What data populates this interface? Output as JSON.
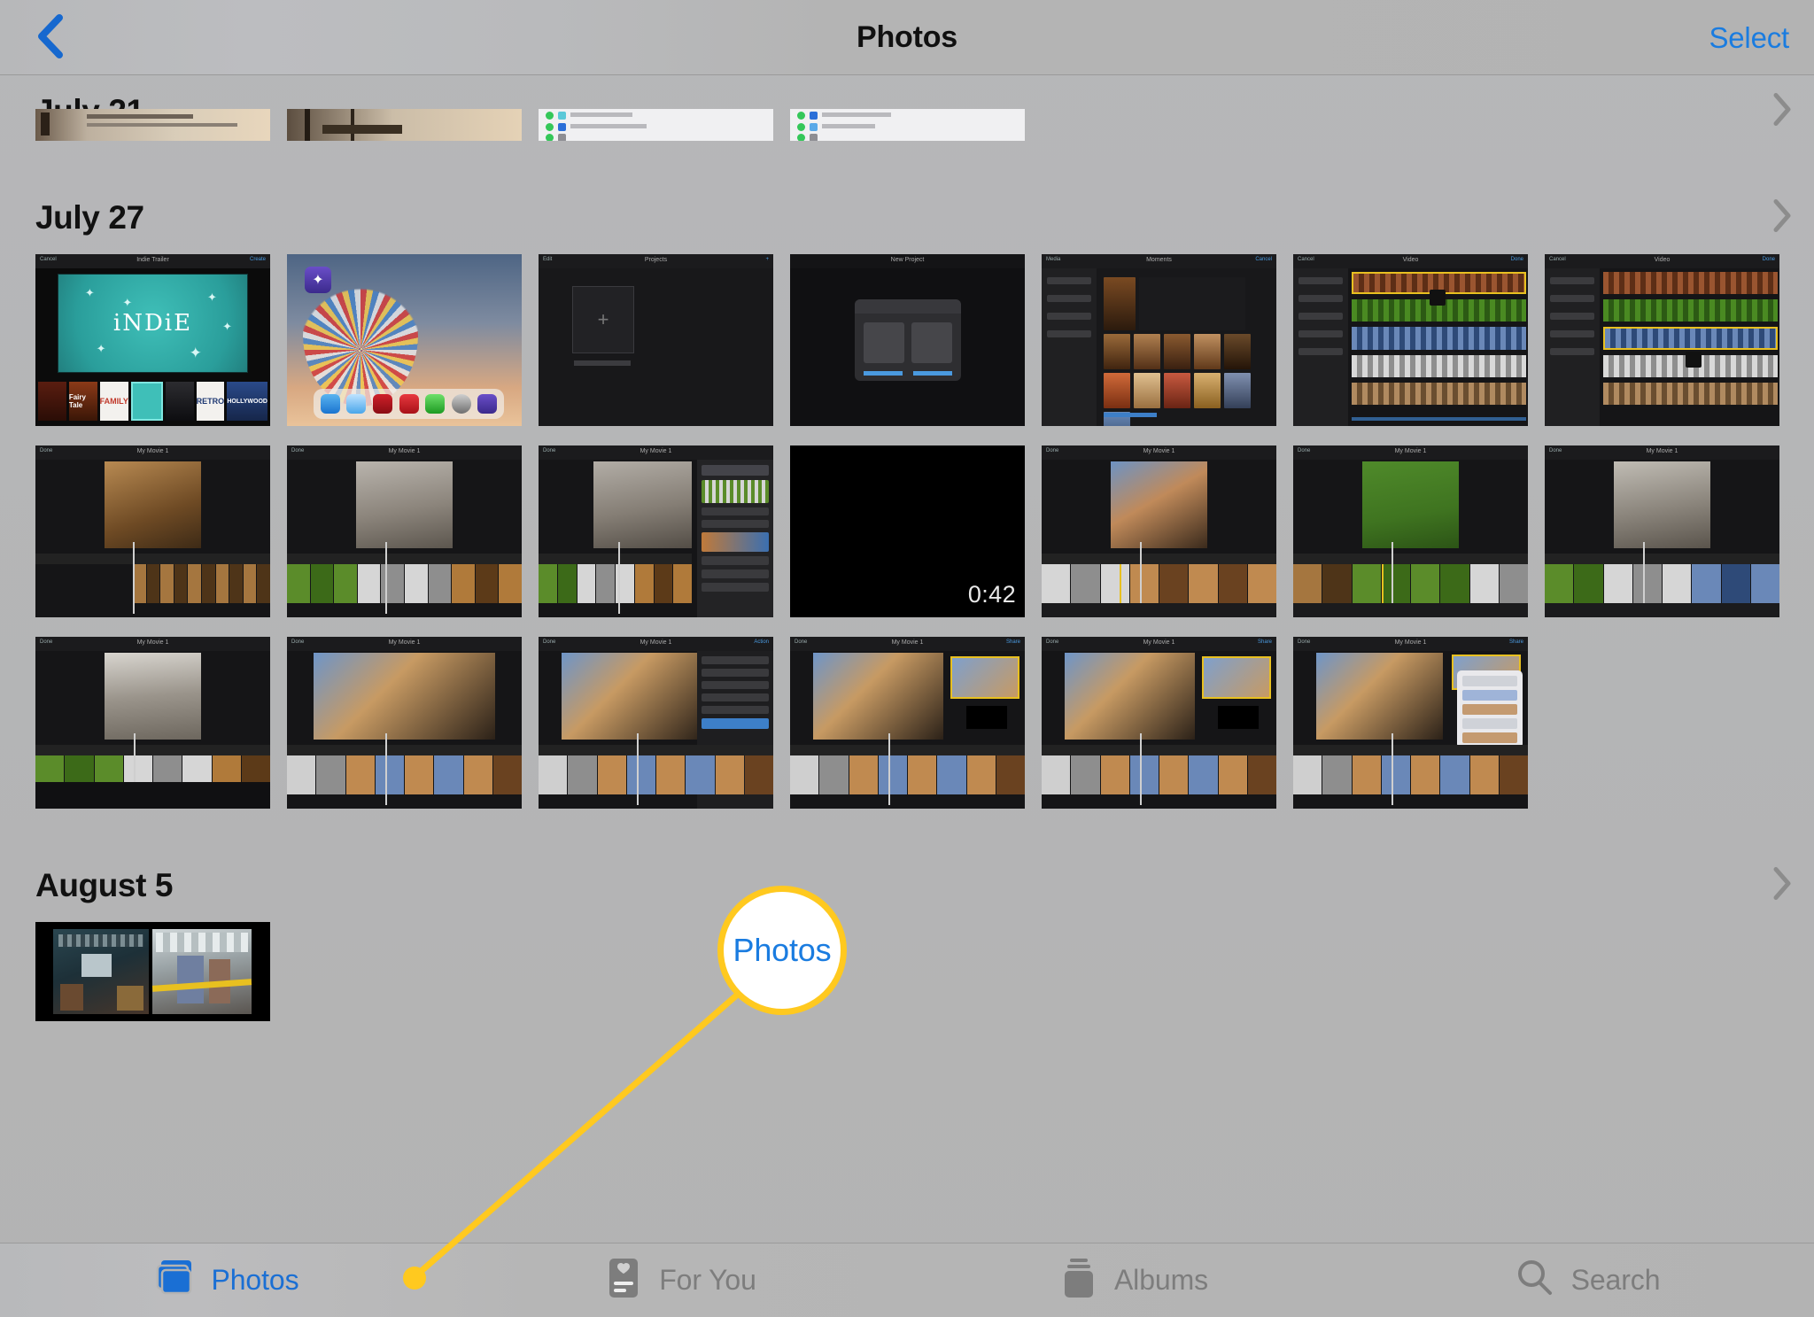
{
  "header": {
    "back_icon": "chevron-left-icon",
    "title": "Photos",
    "select_label": "Select",
    "accent_color": "#1a7ce0"
  },
  "sections": [
    {
      "title": "July 21",
      "chevron_icon": "chevron-right-icon",
      "clipped": true,
      "rows": [
        {
          "items": [
            {
              "kind": "screenshot-top-story"
            },
            {
              "kind": "screenshot-rig"
            },
            {
              "kind": "screenshot-settings-list"
            },
            {
              "kind": "screenshot-settings-list"
            }
          ]
        }
      ]
    },
    {
      "title": "July 27",
      "chevron_icon": "chevron-right-icon",
      "clipped": false,
      "rows": [
        {
          "items": [
            {
              "kind": "imovie-trailer",
              "title_text": "iNDiE",
              "themes": [
                "",
                "Fairy Tale",
                "FAMILY",
                "",
                "",
                "RETRO",
                ""
              ]
            },
            {
              "kind": "ios-homescreen"
            },
            {
              "kind": "imovie-projects-empty",
              "label": "Projects"
            },
            {
              "kind": "imovie-new-project"
            },
            {
              "kind": "imovie-media-browser"
            },
            {
              "kind": "imovie-timeline-a"
            },
            {
              "kind": "imovie-timeline-a"
            }
          ]
        },
        {
          "items": [
            {
              "kind": "imovie-edit",
              "title": "My Movie 1"
            },
            {
              "kind": "imovie-edit",
              "title": "My Movie 1"
            },
            {
              "kind": "imovie-edit-panel",
              "title": "My Movie 1"
            },
            {
              "kind": "video-black",
              "duration": "0:42"
            },
            {
              "kind": "imovie-edit",
              "title": "My Movie 1"
            },
            {
              "kind": "imovie-edit",
              "title": "My Movie 1"
            },
            {
              "kind": "imovie-edit",
              "title": "My Movie 1"
            }
          ]
        },
        {
          "items": [
            {
              "kind": "imovie-edit",
              "title": "My Movie 1"
            },
            {
              "kind": "imovie-edit-dog",
              "title": "My Movie 1"
            },
            {
              "kind": "imovie-edit-share",
              "title": "My Movie 1"
            },
            {
              "kind": "imovie-edit-dog",
              "title": "My Movie 1"
            },
            {
              "kind": "imovie-edit-dog",
              "title": "My Movie 1"
            },
            {
              "kind": "imovie-edit-menu",
              "title": "My Movie 1"
            }
          ]
        }
      ]
    },
    {
      "title": "August 5",
      "chevron_icon": "chevron-right-icon",
      "clipped": false,
      "rows": [
        {
          "items": [
            {
              "kind": "office-scene"
            }
          ]
        }
      ]
    }
  ],
  "tabs": [
    {
      "label": "Photos",
      "icon": "photos-stack-icon",
      "active": true
    },
    {
      "label": "For You",
      "icon": "for-you-card-icon",
      "active": false
    },
    {
      "label": "Albums",
      "icon": "albums-stack-icon",
      "active": false
    },
    {
      "label": "Search",
      "icon": "magnifier-icon",
      "active": false
    }
  ],
  "callout": {
    "label": "Photos",
    "border_color": "#ffc91f",
    "text_color": "#1a7ce0",
    "points_to": "tab-photos"
  }
}
